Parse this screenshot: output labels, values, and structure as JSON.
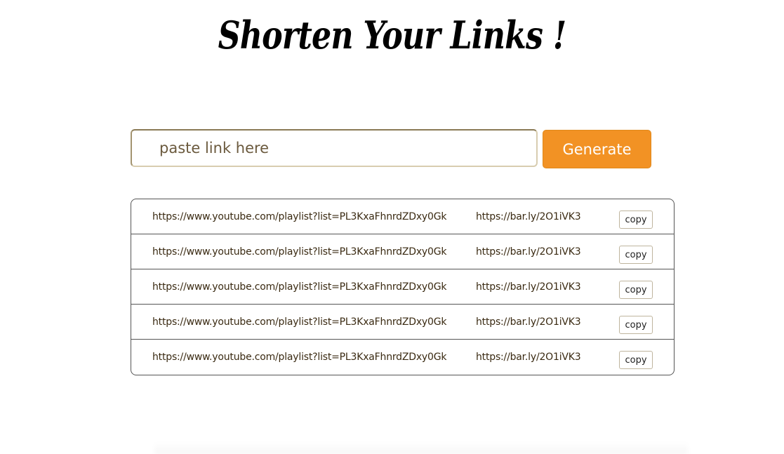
{
  "header": {
    "title": "Shorten Your Links !"
  },
  "form": {
    "input_placeholder": "paste link here",
    "input_value": "",
    "generate_label": "Generate"
  },
  "links": [
    {
      "original": "https://www.youtube.com/playlist?list=PL3KxaFhnrdZDxy0Gk",
      "short": "https://bar.ly/2O1iVK3",
      "copy_label": "copy"
    },
    {
      "original": "https://www.youtube.com/playlist?list=PL3KxaFhnrdZDxy0Gk",
      "short": "https://bar.ly/2O1iVK3",
      "copy_label": "copy"
    },
    {
      "original": "https://www.youtube.com/playlist?list=PL3KxaFhnrdZDxy0Gk",
      "short": "https://bar.ly/2O1iVK3",
      "copy_label": "copy"
    },
    {
      "original": "https://www.youtube.com/playlist?list=PL3KxaFhnrdZDxy0Gk",
      "short": "https://bar.ly/2O1iVK3",
      "copy_label": "copy"
    },
    {
      "original": "https://www.youtube.com/playlist?list=PL3KxaFhnrdZDxy0Gk",
      "short": "https://bar.ly/2O1iVK3",
      "copy_label": "copy"
    }
  ],
  "colors": {
    "accent": "#f29224",
    "text": "#3a2a12",
    "placeholder": "#6b5a3e"
  }
}
